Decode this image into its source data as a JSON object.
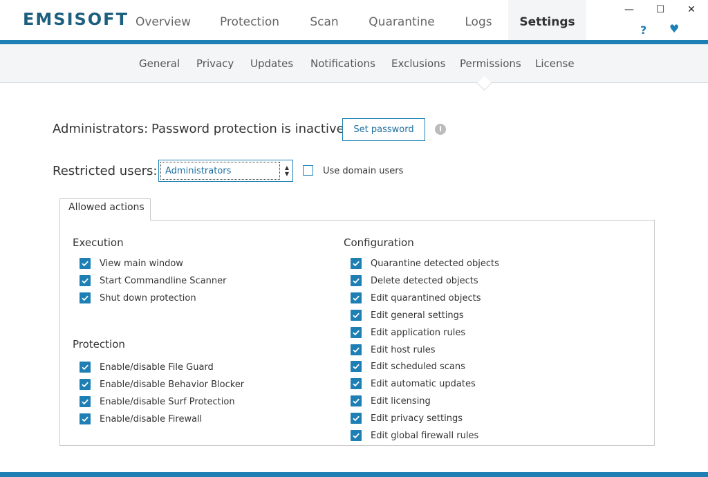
{
  "app": {
    "logo": "EMSISOFT"
  },
  "nav": {
    "tabs": [
      {
        "label": "Overview"
      },
      {
        "label": "Protection"
      },
      {
        "label": "Scan"
      },
      {
        "label": "Quarantine"
      },
      {
        "label": "Logs"
      },
      {
        "label": "Settings",
        "active": true
      }
    ],
    "help": "?",
    "heart": "♥"
  },
  "window": {
    "minimize": "—",
    "maximize": "☐",
    "close": "✕"
  },
  "subnav": {
    "tabs": [
      {
        "label": "General"
      },
      {
        "label": "Privacy"
      },
      {
        "label": "Updates"
      },
      {
        "label": "Notifications"
      },
      {
        "label": "Exclusions"
      },
      {
        "label": "Permissions",
        "active": true
      },
      {
        "label": "License"
      }
    ]
  },
  "admins": {
    "label": "Administrators:",
    "status": "Password protection is inactive",
    "set_password": "Set password",
    "info": "i"
  },
  "restricted": {
    "label": "Restricted users:",
    "selected": "Administrators",
    "use_domain_users": "Use domain users",
    "use_domain_checked": false
  },
  "allowed": {
    "tab_label": "Allowed actions",
    "execution": {
      "title": "Execution",
      "items": [
        "View main window",
        "Start Commandline Scanner",
        "Shut down protection"
      ]
    },
    "protection": {
      "title": "Protection",
      "items": [
        "Enable/disable File Guard",
        "Enable/disable Behavior Blocker",
        "Enable/disable Surf Protection",
        "Enable/disable Firewall"
      ]
    },
    "configuration": {
      "title": "Configuration",
      "items": [
        "Quarantine detected objects",
        "Delete detected objects",
        "Edit quarantined objects",
        "Edit general settings",
        "Edit application rules",
        "Edit host rules",
        "Edit scheduled scans",
        "Edit automatic updates",
        "Edit licensing",
        "Edit privacy settings",
        "Edit global firewall rules"
      ]
    }
  },
  "colors": {
    "accent": "#1d7fb4",
    "logo": "#1d5f7f",
    "subnav_bg": "#f3f5f6"
  }
}
